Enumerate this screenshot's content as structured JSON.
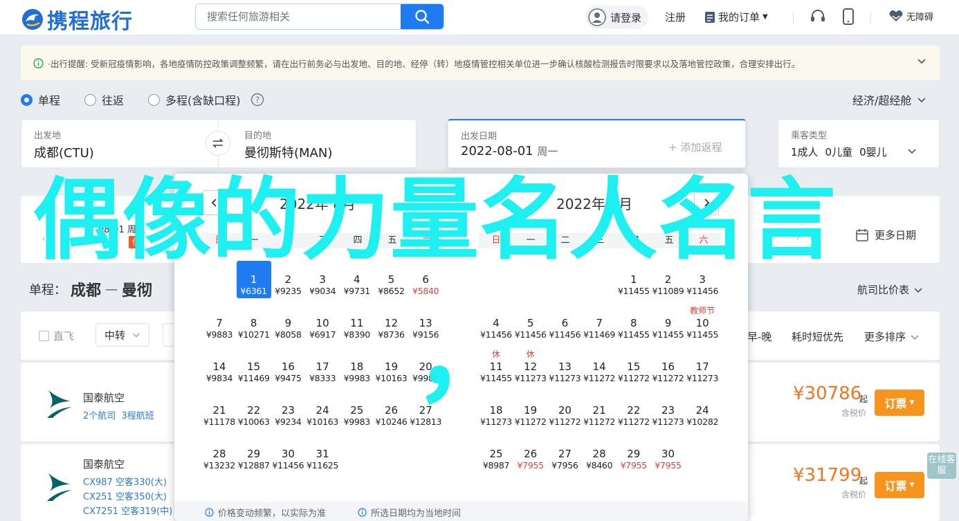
{
  "header": {
    "logo_text": "携程旅行",
    "search_placeholder": "搜索任何旅游相关",
    "login": "请登录",
    "register": "注册",
    "my_orders": "我的订单",
    "accessibility": "无障碍"
  },
  "notice": {
    "text": "·出行提醒: 受新冠疫情影响，各地疫情防控政策调整频繁，请在出行前务必与出发地、目的地、经停（转）地疫情管控相关单位进一步确认核酸检测报告时限要求以及落地管控政策，合理安排出行。"
  },
  "trip_types": [
    "单程",
    "往返",
    "多程(含缺口程)"
  ],
  "selected_trip": "单程",
  "cabin": "经济/超经舱",
  "search": {
    "from_label": "出发地",
    "from_value": "成都(CTU)",
    "to_label": "目的地",
    "to_value": "曼彻斯特(MAN)",
    "date_label": "出发日期",
    "date_value": "2022-08-01",
    "date_weekday": "周一",
    "return_placeholder": "+ 添加返程",
    "pax_label": "乘客类型",
    "pax_adult": "1成人",
    "pax_child": "0儿童",
    "pax_infant": "0婴儿"
  },
  "datebar": {
    "left_date": "08-01 周五",
    "low_badge": "低",
    "more_dates": "更多日期"
  },
  "route": {
    "prefix": "单程：",
    "from": "成都",
    "to": "曼彻",
    "compare": "航司比价表"
  },
  "filters": {
    "direct": "直飞",
    "transfer": "中转",
    "sort_time": "早-晚",
    "sort_duration": "耗时短优先",
    "more_sort": "更多排序"
  },
  "flights": [
    {
      "airline": "国泰航空",
      "sub": "2个航司  3程航班",
      "price": "¥30786",
      "price_suffix": "起",
      "tax": "含税价",
      "book": "订票"
    },
    {
      "airline": "国泰航空",
      "legs": [
        "CX987 空客330(大)",
        "CX251 空客350(大)",
        "CX7251 空客319(中)"
      ],
      "price": "¥31799",
      "price_suffix": "起",
      "tax": "含税价",
      "book": "订票"
    }
  ],
  "calendar": {
    "month1": "2022年 8月",
    "month2": "2022年 9月",
    "weekdays": [
      "日",
      "一",
      "二",
      "三",
      "四",
      "五",
      "六"
    ],
    "aug": [
      {
        "d": "1",
        "p": "¥6361",
        "sel": true
      },
      {
        "d": "2",
        "p": "¥9235"
      },
      {
        "d": "3",
        "p": "¥9034"
      },
      {
        "d": "4",
        "p": "¥9731"
      },
      {
        "d": "5",
        "p": "¥8652"
      },
      {
        "d": "6",
        "p": "¥5840",
        "red": true
      },
      {
        "d": "7",
        "p": "¥9883"
      },
      {
        "d": "8",
        "p": "¥10271"
      },
      {
        "d": "9",
        "p": "¥8058"
      },
      {
        "d": "10",
        "p": "¥6917"
      },
      {
        "d": "11",
        "p": "¥8390"
      },
      {
        "d": "12",
        "p": "¥8736"
      },
      {
        "d": "13",
        "p": "¥9156"
      },
      {
        "d": "14",
        "p": "¥9834"
      },
      {
        "d": "15",
        "p": "¥11469"
      },
      {
        "d": "16",
        "p": "¥9475"
      },
      {
        "d": "17",
        "p": "¥8333"
      },
      {
        "d": "18",
        "p": "¥9983"
      },
      {
        "d": "19",
        "p": "¥10163"
      },
      {
        "d": "20",
        "p": "¥9983"
      },
      {
        "d": "21",
        "p": "¥11178"
      },
      {
        "d": "22",
        "p": "¥10063"
      },
      {
        "d": "23",
        "p": "¥9234"
      },
      {
        "d": "24",
        "p": "¥10163"
      },
      {
        "d": "25",
        "p": "¥9983"
      },
      {
        "d": "26",
        "p": "¥10246"
      },
      {
        "d": "27",
        "p": "¥12813"
      },
      {
        "d": "28",
        "p": "¥13232"
      },
      {
        "d": "29",
        "p": "¥12887"
      },
      {
        "d": "30",
        "p": "¥11456"
      },
      {
        "d": "31",
        "p": "¥11625"
      }
    ],
    "sep": [
      {
        "d": "1",
        "p": "¥11455"
      },
      {
        "d": "2",
        "p": "¥11089"
      },
      {
        "d": "3",
        "p": "¥11456"
      },
      {
        "d": "4",
        "p": "¥11456"
      },
      {
        "d": "5",
        "p": "¥11456"
      },
      {
        "d": "6",
        "p": "¥11456"
      },
      {
        "d": "7",
        "p": "¥11469"
      },
      {
        "d": "8",
        "p": "¥11455"
      },
      {
        "d": "9",
        "p": "¥11455"
      },
      {
        "d": "10",
        "p": "¥11455",
        "tag": "教师节"
      },
      {
        "d": "11",
        "p": "¥11455",
        "tag": "休"
      },
      {
        "d": "12",
        "p": "¥11273",
        "tag": "休"
      },
      {
        "d": "13",
        "p": "¥11273"
      },
      {
        "d": "14",
        "p": "¥11272"
      },
      {
        "d": "15",
        "p": "¥11272"
      },
      {
        "d": "16",
        "p": "¥11272"
      },
      {
        "d": "17",
        "p": "¥11273"
      },
      {
        "d": "18",
        "p": "¥11273"
      },
      {
        "d": "19",
        "p": "¥11272"
      },
      {
        "d": "20",
        "p": "¥11272"
      },
      {
        "d": "21",
        "p": "¥11272"
      },
      {
        "d": "22",
        "p": "¥11272"
      },
      {
        "d": "23",
        "p": "¥11273"
      },
      {
        "d": "24",
        "p": "¥10282"
      },
      {
        "d": "25",
        "p": "¥8987"
      },
      {
        "d": "26",
        "p": "¥7955",
        "red": true
      },
      {
        "d": "27",
        "p": "¥7956"
      },
      {
        "d": "28",
        "p": "¥8460"
      },
      {
        "d": "29",
        "p": "¥7955",
        "red": true
      },
      {
        "d": "30",
        "p": "¥7955",
        "red": true
      }
    ],
    "hint1": "价格变动频繁，以实际为准",
    "hint2": "所选日期均为当地时间"
  },
  "overlay": {
    "text": "偶像的力量名人名言",
    "comma": "，"
  },
  "side_tab": "在线客服",
  "colors": {
    "accent": "#1e7bf2",
    "orange": "#f7941d",
    "price": "#f7741d",
    "red": "#e2403a",
    "overlay": "#1ef0f2"
  }
}
